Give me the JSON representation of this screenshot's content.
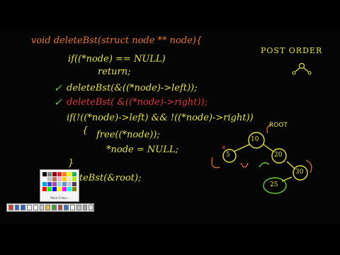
{
  "code": {
    "signature": "void deleteBst(struct node ** node){",
    "if_null": "if((*node) == NULL)",
    "return_stmt": "return;",
    "recurse_left": "deleteBst(&((*node)->left));",
    "recurse_right": "deleteBst( &((*node)->right));",
    "if_leaf": "if(!((*node)->left) && !((*node)->right))",
    "open_brace": "{",
    "free_stmt": "free((*node));",
    "assign_null": "*node = NULL;",
    "close_brace": "}",
    "call": "deleteBst(&root);"
  },
  "title": "POST ORDER",
  "tree": {
    "root_label": "ROOT",
    "nodes": [
      "10",
      "5",
      "20",
      "30",
      "25"
    ]
  },
  "colors": {
    "code_yellow": "#e6e24a",
    "signature_orange": "#e8772e",
    "check_green": "#6bcf3a",
    "red": "#e0383a"
  },
  "palette": {
    "more_colors": "More Colors...",
    "swatches": [
      "#000000",
      "#7f7f7f",
      "#880015",
      "#ed1c24",
      "#ff7f27",
      "#fff200",
      "#22b14c",
      "#ffffff",
      "#c3c3c3",
      "#b97a57",
      "#ffaec9",
      "#ffc90e",
      "#efe4b0",
      "#b5e61d",
      "#00a2e8",
      "#3f48cc",
      "#a349a4",
      "#99d9ea",
      "#7092be",
      "#c8bfe7",
      "#404040",
      "#ff0000",
      "#00ff00",
      "#0000ff",
      "#ffff00",
      "#ff00ff",
      "#00ffff",
      "#808000"
    ]
  },
  "toolbar": {
    "tools": [
      "#d04030",
      "#3060c0",
      "#3060c0",
      "#f0f0f0",
      "#f0f0f0",
      "#d0d0d0",
      "#e0c040",
      "#40a040",
      "#c04040",
      "#4070c0",
      "#f0f0f0",
      "#c0c0c0",
      "#a0a0a0",
      "#e0e0e0"
    ]
  }
}
